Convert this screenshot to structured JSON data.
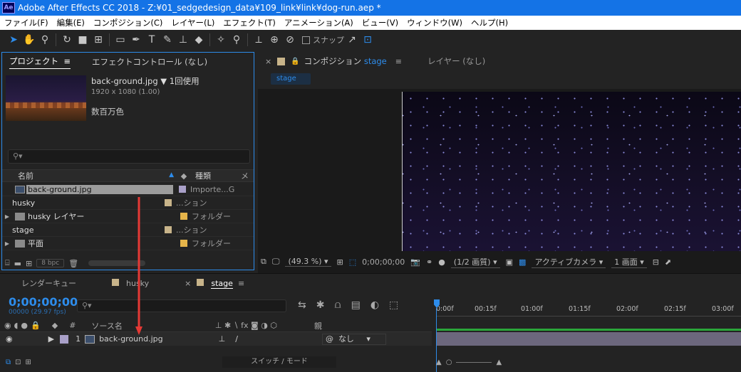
{
  "title": "Adobe After Effects CC 2018 - Z:¥01_sedgedesign_data¥109_link¥link¥dog-run.aep *",
  "app_icon": "Ae",
  "menu": [
    "ファイル(F)",
    "編集(E)",
    "コンポジション(C)",
    "レイヤー(L)",
    "エフェクト(T)",
    "アニメーション(A)",
    "ビュー(V)",
    "ウィンドウ(W)",
    "ヘルプ(H)"
  ],
  "toolbar": {
    "snap_label": "スナップ"
  },
  "project": {
    "tab_project": "プロジェクト",
    "tab_menu": "≡",
    "tab_effects": "エフェクトコントロール (なし)",
    "selected_name": "back-ground.jpg",
    "usage": "1回使用",
    "dimensions": "1920 x 1080 (1.00)",
    "colors": "数百万色",
    "search_glyph": "⚲▾",
    "col_name": "名前",
    "col_type": "種類",
    "col_extra": "メ",
    "items": [
      {
        "name": "back-ground.jpg",
        "type": "Importe...G",
        "icon": "image-icon",
        "label_color": "#a9a0c8"
      },
      {
        "name": "husky",
        "type": "...ション",
        "icon": "composition-icon",
        "label_color": "#c8b48a"
      },
      {
        "name": "husky レイヤー",
        "type": "フォルダー",
        "icon": "folder-icon",
        "label_color": "#e6b54a"
      },
      {
        "name": "stage",
        "type": "...ション",
        "icon": "composition-icon",
        "label_color": "#c8b48a"
      },
      {
        "name": "平面",
        "type": "フォルダー",
        "icon": "folder-icon",
        "label_color": "#e6b54a"
      }
    ],
    "bpc": "8 bpc"
  },
  "composition": {
    "tab_prefix": "コンポジション",
    "tab_comp_name": "stage",
    "tab_menu": "≡",
    "layer_tab": "レイヤー (なし)",
    "badge": "stage",
    "zoom": "(49.3 %)",
    "timecode": "0;00;00;00",
    "resolution": "(1/2 画質)",
    "camera": "アクティブカメラ",
    "views": "1 画面"
  },
  "timeline": {
    "tab_render": "レンダーキュー",
    "tab_husky": "husky",
    "tab_stage": "stage",
    "tab_menu": "≡",
    "timecode": "0;00;00;00",
    "fps": "00000 (29.97 fps)",
    "search_glyph": "⚲▾",
    "ruler": [
      "0:00f",
      "00:15f",
      "01:00f",
      "01:15f",
      "02:00f",
      "02:15f",
      "03:00f"
    ],
    "col_num": "#",
    "col_source": "ソース名",
    "col_parent": "親",
    "layer": {
      "num": "1",
      "name": "back-ground.jpg",
      "parent": "なし"
    },
    "switch_mode": "スイッチ / モード"
  },
  "accent_color": "#2d8ceb",
  "arrow_color": "#e53935"
}
